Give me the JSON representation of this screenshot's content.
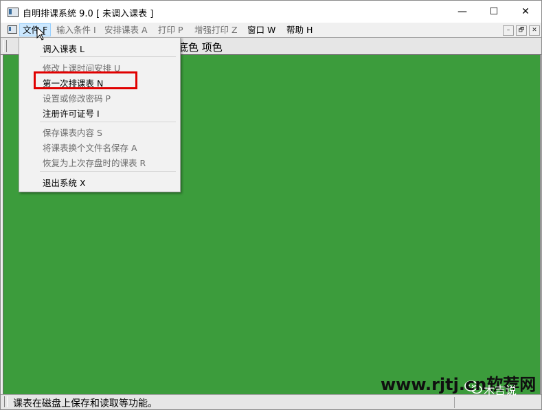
{
  "window": {
    "title": "自明排课系统 9.0 [ 未调入课表 ]",
    "controls": {
      "minimize": "—",
      "maximize": "☐",
      "close": "✕"
    }
  },
  "menubar": {
    "items": [
      {
        "label": "文件 F",
        "state": "open"
      },
      {
        "label": "输入条件 I",
        "state": "disabled"
      },
      {
        "label": "安排课表 A",
        "state": "disabled"
      },
      {
        "label": "打印 P",
        "state": "disabled"
      },
      {
        "label": "增强打印 Z",
        "state": "disabled"
      },
      {
        "label": "窗口 W",
        "state": "enabled"
      },
      {
        "label": "帮助 H",
        "state": "enabled"
      }
    ],
    "mdi_controls": {
      "minimize": "–",
      "restore": "🗗",
      "close": "✕"
    }
  },
  "toolbar": {
    "partial_text": "底色  项色"
  },
  "file_menu": {
    "items": [
      {
        "label": "调入课表 L",
        "enabled": true
      },
      {
        "label": "修改上课时间安排 U",
        "enabled": false
      },
      {
        "label": "第一次排课表 N",
        "enabled": true,
        "highlighted": true
      },
      {
        "label": "设置或修改密码 P",
        "enabled": false
      },
      {
        "label": "注册许可证号 I",
        "enabled": true
      },
      {
        "label": "保存课表内容 S",
        "enabled": false
      },
      {
        "label": "将课表换个文件名保存 A",
        "enabled": false
      },
      {
        "label": "恢复为上次存盘时的课表 R",
        "enabled": false
      },
      {
        "label": "退出系统 X",
        "enabled": true
      }
    ]
  },
  "statusbar": {
    "text": "课表在磁盘上保存和读取等功能。"
  },
  "watermark": {
    "site": "www.rjtj.cn软荐网",
    "channel": "木吉说"
  },
  "colors": {
    "workspace": "#3c9c3c",
    "highlight_box": "#e00000",
    "menu_active_bg": "#cce8ff"
  },
  "icons": [
    "app-icon",
    "mdi-child-icon",
    "mouse-cursor-icon",
    "wechat-icon"
  ]
}
